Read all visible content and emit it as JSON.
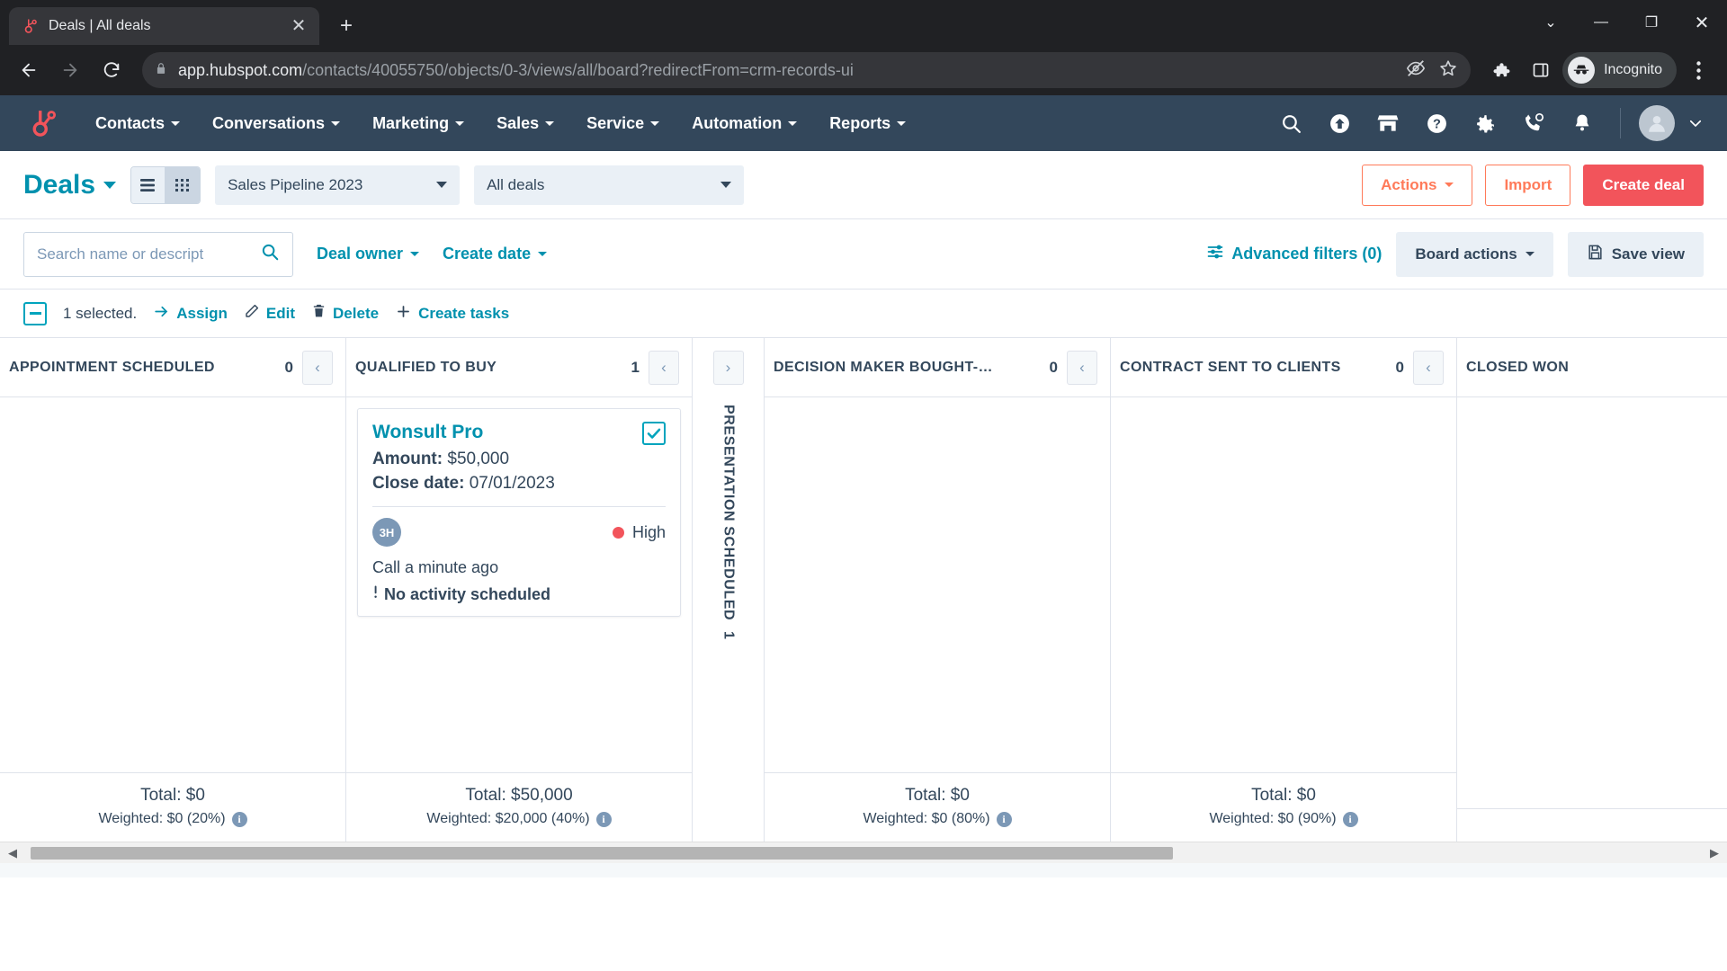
{
  "browser": {
    "tab": {
      "title": "Deals | All deals",
      "favicon": "hubspot-sprocket-icon",
      "close_icon": "close-icon"
    },
    "new_tab_icon": "plus-icon",
    "window_controls": [
      "chevron-down-icon",
      "minimize-icon",
      "maximize-icon",
      "close-icon"
    ],
    "back_icon": "back-arrow-icon",
    "forward_icon": "forward-arrow-icon",
    "reload_icon": "reload-icon",
    "lock_icon": "lock-icon",
    "url_domain": "app.hubspot.com",
    "url_path": "/contacts/40055750/objects/0-3/views/all/board?redirectFrom=crm-records-ui",
    "url_icons": [
      "eye-off-icon",
      "star-icon"
    ],
    "right_icons": [
      "extensions-puzzle-icon",
      "side-panel-icon"
    ],
    "profile_label": "Incognito",
    "profile_icon": "incognito-hat-icon",
    "menu_icon": "three-dot-menu-icon"
  },
  "hs_nav": {
    "logo": "hubspot-sprocket-icon",
    "items": [
      {
        "label": "Contacts"
      },
      {
        "label": "Conversations"
      },
      {
        "label": "Marketing"
      },
      {
        "label": "Sales"
      },
      {
        "label": "Service"
      },
      {
        "label": "Automation"
      },
      {
        "label": "Reports"
      }
    ],
    "icons": [
      {
        "name": "search-icon"
      },
      {
        "name": "upgrade-arrow-icon"
      },
      {
        "name": "marketplace-store-icon"
      },
      {
        "name": "help-question-icon"
      },
      {
        "name": "settings-gear-icon"
      },
      {
        "name": "phone-call-icon"
      },
      {
        "name": "notifications-bell-icon"
      }
    ],
    "avatar": "user-avatar",
    "avatar_caret": "chevron-down-icon"
  },
  "toolbar": {
    "title": "Deals",
    "title_caret": "chevron-down-icon",
    "view_list_icon": "list-view-icon",
    "view_board_icon": "board-view-icon",
    "pipeline_select": "Sales Pipeline 2023",
    "view_select": "All deals",
    "actions_label": "Actions",
    "import_label": "Import",
    "create_deal_label": "Create deal",
    "primary_color": "#f2545b",
    "accent_color": "#ff7a59"
  },
  "filters": {
    "search_placeholder": "Search name or descript",
    "search_value": "",
    "search_icon": "search-icon",
    "deal_owner_label": "Deal owner",
    "create_date_label": "Create date",
    "advanced_filters_label": "Advanced filters (0)",
    "advanced_filters_icon": "filter-sliders-icon",
    "board_actions_label": "Board actions",
    "save_view_label": "Save view",
    "save_view_icon": "save-disk-icon"
  },
  "selection": {
    "checkbox_state": "indeterminate",
    "count_label": "1 selected.",
    "actions": [
      {
        "label": "Assign",
        "icon": "arrow-right-icon"
      },
      {
        "label": "Edit",
        "icon": "pencil-icon"
      },
      {
        "label": "Delete",
        "icon": "trash-icon"
      },
      {
        "label": "Create tasks",
        "icon": "plus-icon"
      }
    ]
  },
  "board": {
    "columns": [
      {
        "name": "APPOINTMENT SCHEDULED",
        "count": "0",
        "collapsed": false,
        "collapse_icon": "chevron-left-icon",
        "total": "Total: $0",
        "weighted": "Weighted: $0 (20%)",
        "cards": []
      },
      {
        "name": "QUALIFIED TO BUY",
        "count": "1",
        "collapsed": false,
        "collapse_icon": "chevron-left-icon",
        "total": "Total: $50,000",
        "weighted": "Weighted: $20,000 (40%)",
        "cards": [
          {
            "name": "Wonsult Pro",
            "selected": true,
            "amount_label": "Amount:",
            "amount_value": "$50,000",
            "close_date_label": "Close date:",
            "close_date_value": "07/01/2023",
            "owner_initials": "3H",
            "priority": "High",
            "priority_color": "#f2545b",
            "last_activity": "Call a minute ago",
            "next_activity": "No activity scheduled",
            "next_activity_icon": "alert-icon"
          }
        ]
      },
      {
        "name": "PRESENTATION SCHEDULED",
        "count": "1",
        "collapsed": true,
        "expand_icon": "chevron-right-icon"
      },
      {
        "name": "DECISION MAKER BOUGHT-…",
        "count": "0",
        "collapsed": false,
        "collapse_icon": "chevron-left-icon",
        "total": "Total: $0",
        "weighted": "Weighted: $0 (80%)",
        "cards": []
      },
      {
        "name": "CONTRACT SENT TO CLIENTS",
        "count": "0",
        "collapsed": false,
        "collapse_icon": "chevron-left-icon",
        "total": "Total: $0",
        "weighted": "Weighted: $0 (90%)",
        "cards": []
      },
      {
        "name": "CLOSED WON",
        "count": "",
        "collapsed": false,
        "collapse_icon": "chevron-left-icon",
        "total": "",
        "weighted": "",
        "cards": []
      }
    ]
  },
  "scrollbar": {
    "left_icon": "chevron-left-icon",
    "right_icon": "chevron-right-icon"
  }
}
